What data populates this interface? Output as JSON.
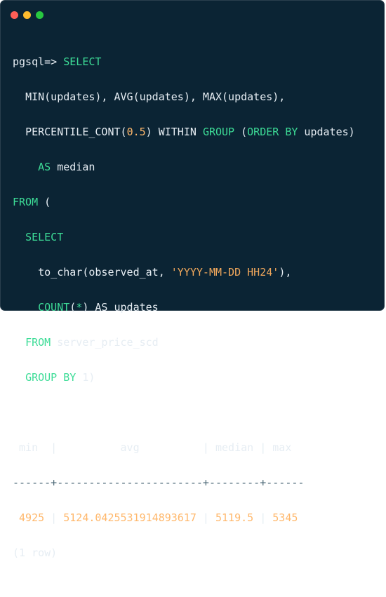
{
  "window": {
    "controls": [
      "close",
      "minimize",
      "maximize"
    ],
    "colors": {
      "close": "#ff5f57",
      "minimize": "#febc2e",
      "maximize": "#28c840"
    }
  },
  "terminal": {
    "prompt": "pgsql=>",
    "query": {
      "l1_kw": "SELECT",
      "l2": "MIN(updates), AVG(updates), MAX(updates),",
      "l3_a": "PERCENTILE_CONT(",
      "l3_num": "0.5",
      "l3_b": ") WITHIN ",
      "l3_kw1": "GROUP",
      "l3_c": " (",
      "l3_kw2": "ORDER BY",
      "l3_d": " updates)",
      "l4_kw": "AS",
      "l4_b": " median",
      "l5_kw": "FROM",
      "l5_b": " (",
      "l6_kw": "SELECT",
      "l7_a": "to_char(observed_at, ",
      "l7_str": "'YYYY-MM-DD HH24'",
      "l7_b": "),",
      "l8_kw": "COUNT",
      "l8_a": "(",
      "l8_star": "*",
      "l8_b": ") AS updates",
      "l9_kw": "FROM",
      "l9_b": " server_price_scd",
      "l10_kw": "GROUP BY",
      "l10_num": "1",
      "l10_b": ")"
    },
    "result": {
      "header": " min  |          avg          | median | max",
      "separator": "------+-----------------------+--------+------",
      "row": {
        "min": "4925",
        "avg": "5124.0425531914893617",
        "median": "5119.5",
        "max": "5345"
      },
      "footer": "(1 row)"
    },
    "colors": {
      "background": "#0b2434",
      "keyword": "#3ddc97",
      "number": "#ffb86c",
      "text": "#e6edf3"
    }
  }
}
